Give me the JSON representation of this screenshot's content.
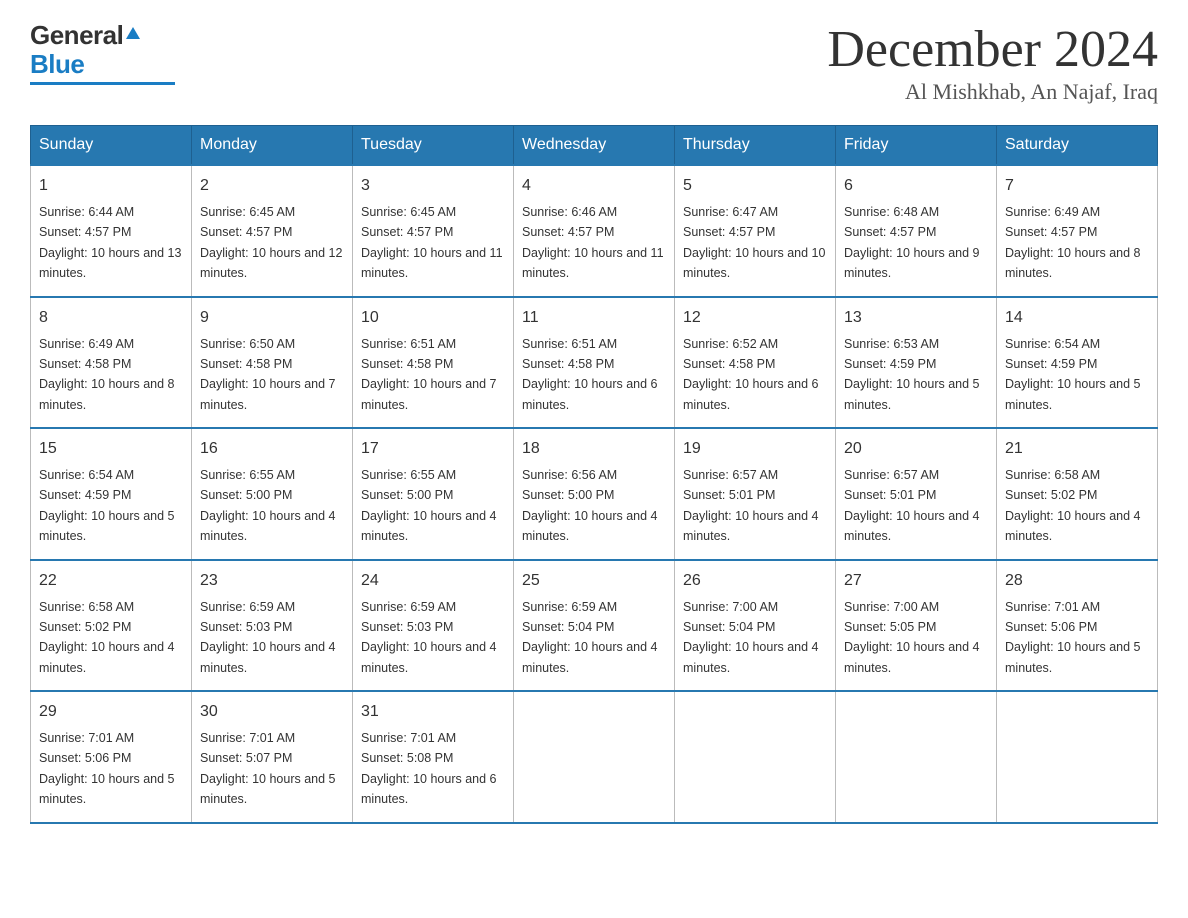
{
  "header": {
    "logo_general": "General",
    "logo_blue": "Blue",
    "month_title": "December 2024",
    "location": "Al Mishkhab, An Najaf, Iraq"
  },
  "weekdays": [
    "Sunday",
    "Monday",
    "Tuesday",
    "Wednesday",
    "Thursday",
    "Friday",
    "Saturday"
  ],
  "weeks": [
    [
      {
        "day": "1",
        "sunrise": "6:44 AM",
        "sunset": "4:57 PM",
        "daylight": "10 hours and 13 minutes."
      },
      {
        "day": "2",
        "sunrise": "6:45 AM",
        "sunset": "4:57 PM",
        "daylight": "10 hours and 12 minutes."
      },
      {
        "day": "3",
        "sunrise": "6:45 AM",
        "sunset": "4:57 PM",
        "daylight": "10 hours and 11 minutes."
      },
      {
        "day": "4",
        "sunrise": "6:46 AM",
        "sunset": "4:57 PM",
        "daylight": "10 hours and 11 minutes."
      },
      {
        "day": "5",
        "sunrise": "6:47 AM",
        "sunset": "4:57 PM",
        "daylight": "10 hours and 10 minutes."
      },
      {
        "day": "6",
        "sunrise": "6:48 AM",
        "sunset": "4:57 PM",
        "daylight": "10 hours and 9 minutes."
      },
      {
        "day": "7",
        "sunrise": "6:49 AM",
        "sunset": "4:57 PM",
        "daylight": "10 hours and 8 minutes."
      }
    ],
    [
      {
        "day": "8",
        "sunrise": "6:49 AM",
        "sunset": "4:58 PM",
        "daylight": "10 hours and 8 minutes."
      },
      {
        "day": "9",
        "sunrise": "6:50 AM",
        "sunset": "4:58 PM",
        "daylight": "10 hours and 7 minutes."
      },
      {
        "day": "10",
        "sunrise": "6:51 AM",
        "sunset": "4:58 PM",
        "daylight": "10 hours and 7 minutes."
      },
      {
        "day": "11",
        "sunrise": "6:51 AM",
        "sunset": "4:58 PM",
        "daylight": "10 hours and 6 minutes."
      },
      {
        "day": "12",
        "sunrise": "6:52 AM",
        "sunset": "4:58 PM",
        "daylight": "10 hours and 6 minutes."
      },
      {
        "day": "13",
        "sunrise": "6:53 AM",
        "sunset": "4:59 PM",
        "daylight": "10 hours and 5 minutes."
      },
      {
        "day": "14",
        "sunrise": "6:54 AM",
        "sunset": "4:59 PM",
        "daylight": "10 hours and 5 minutes."
      }
    ],
    [
      {
        "day": "15",
        "sunrise": "6:54 AM",
        "sunset": "4:59 PM",
        "daylight": "10 hours and 5 minutes."
      },
      {
        "day": "16",
        "sunrise": "6:55 AM",
        "sunset": "5:00 PM",
        "daylight": "10 hours and 4 minutes."
      },
      {
        "day": "17",
        "sunrise": "6:55 AM",
        "sunset": "5:00 PM",
        "daylight": "10 hours and 4 minutes."
      },
      {
        "day": "18",
        "sunrise": "6:56 AM",
        "sunset": "5:00 PM",
        "daylight": "10 hours and 4 minutes."
      },
      {
        "day": "19",
        "sunrise": "6:57 AM",
        "sunset": "5:01 PM",
        "daylight": "10 hours and 4 minutes."
      },
      {
        "day": "20",
        "sunrise": "6:57 AM",
        "sunset": "5:01 PM",
        "daylight": "10 hours and 4 minutes."
      },
      {
        "day": "21",
        "sunrise": "6:58 AM",
        "sunset": "5:02 PM",
        "daylight": "10 hours and 4 minutes."
      }
    ],
    [
      {
        "day": "22",
        "sunrise": "6:58 AM",
        "sunset": "5:02 PM",
        "daylight": "10 hours and 4 minutes."
      },
      {
        "day": "23",
        "sunrise": "6:59 AM",
        "sunset": "5:03 PM",
        "daylight": "10 hours and 4 minutes."
      },
      {
        "day": "24",
        "sunrise": "6:59 AM",
        "sunset": "5:03 PM",
        "daylight": "10 hours and 4 minutes."
      },
      {
        "day": "25",
        "sunrise": "6:59 AM",
        "sunset": "5:04 PM",
        "daylight": "10 hours and 4 minutes."
      },
      {
        "day": "26",
        "sunrise": "7:00 AM",
        "sunset": "5:04 PM",
        "daylight": "10 hours and 4 minutes."
      },
      {
        "day": "27",
        "sunrise": "7:00 AM",
        "sunset": "5:05 PM",
        "daylight": "10 hours and 4 minutes."
      },
      {
        "day": "28",
        "sunrise": "7:01 AM",
        "sunset": "5:06 PM",
        "daylight": "10 hours and 5 minutes."
      }
    ],
    [
      {
        "day": "29",
        "sunrise": "7:01 AM",
        "sunset": "5:06 PM",
        "daylight": "10 hours and 5 minutes."
      },
      {
        "day": "30",
        "sunrise": "7:01 AM",
        "sunset": "5:07 PM",
        "daylight": "10 hours and 5 minutes."
      },
      {
        "day": "31",
        "sunrise": "7:01 AM",
        "sunset": "5:08 PM",
        "daylight": "10 hours and 6 minutes."
      },
      null,
      null,
      null,
      null
    ]
  ]
}
